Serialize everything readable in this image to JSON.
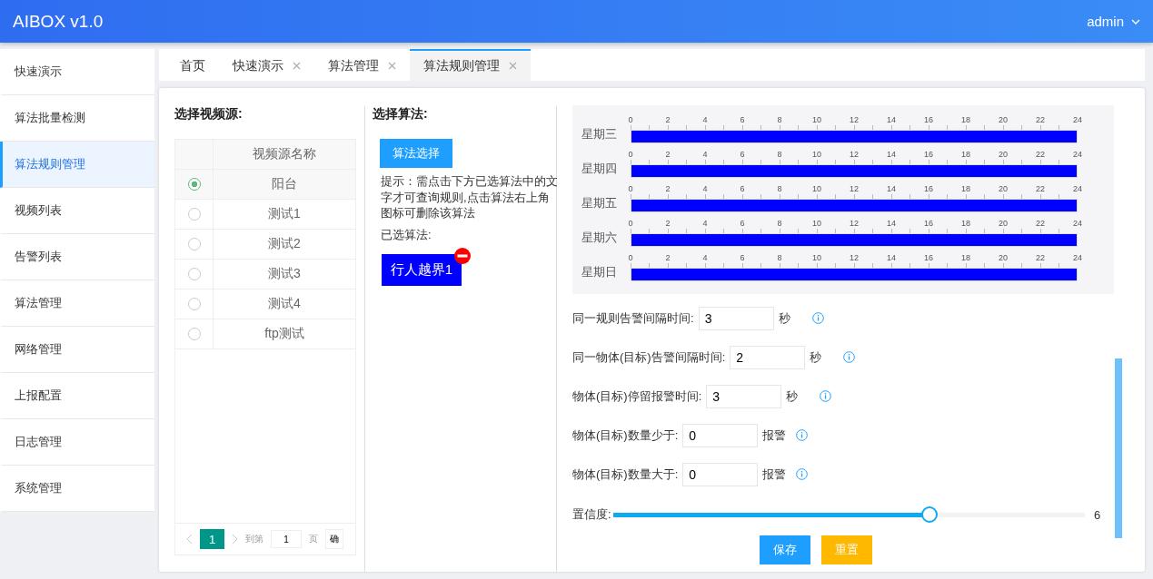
{
  "header": {
    "title": "AIBOX v1.0",
    "user": "admin"
  },
  "sidebar": {
    "items": [
      {
        "label": "快速演示",
        "selected": false
      },
      {
        "label": "算法批量检测",
        "selected": false
      },
      {
        "label": "算法规则管理",
        "selected": true
      },
      {
        "label": "视频列表",
        "selected": false
      },
      {
        "label": "告警列表",
        "selected": false
      },
      {
        "label": "算法管理",
        "selected": false
      },
      {
        "label": "网络管理",
        "selected": false
      },
      {
        "label": "上报配置",
        "selected": false
      },
      {
        "label": "日志管理",
        "selected": false
      },
      {
        "label": "系统管理",
        "selected": false
      }
    ]
  },
  "tabs": [
    {
      "label": "首页",
      "selected": false,
      "closable": false
    },
    {
      "label": "快速演示",
      "selected": false,
      "closable": true
    },
    {
      "label": "算法管理",
      "selected": false,
      "closable": true
    },
    {
      "label": "算法规则管理",
      "selected": true,
      "closable": true
    }
  ],
  "video_source": {
    "title": "选择视频源:",
    "column": "视频源名称",
    "rows": [
      {
        "name": "阳台",
        "selected": true
      },
      {
        "name": "测试1",
        "selected": false
      },
      {
        "name": "测试2",
        "selected": false
      },
      {
        "name": "测试3",
        "selected": false
      },
      {
        "name": "测试4",
        "selected": false
      },
      {
        "name": "ftp测试",
        "selected": false
      }
    ],
    "pagination": {
      "current": "1",
      "goto_label": "到第",
      "page_value": "1",
      "page_label": "页",
      "confirm": "确"
    }
  },
  "algorithm": {
    "title": "选择算法:",
    "select_button": "算法选择",
    "hint": "提示：需点击下方已选算法中的文字才可查询规则,点击算法右上角图标可删除该算法",
    "selected_label": "已选算法:",
    "selected": [
      "行人越界1"
    ]
  },
  "schedule": [
    {
      "day": "星期三",
      "level": 1,
      "ticks": [
        "0",
        "2",
        "4",
        "6",
        "8",
        "10",
        "12",
        "14",
        "16",
        "18",
        "20",
        "22",
        "24"
      ]
    },
    {
      "day": "星期四",
      "level": 1,
      "ticks": [
        "0",
        "2",
        "4",
        "6",
        "8",
        "10",
        "12",
        "14",
        "16",
        "18",
        "20",
        "22",
        "24"
      ]
    },
    {
      "day": "星期五",
      "level": 1,
      "ticks": [
        "0",
        "2",
        "4",
        "6",
        "8",
        "10",
        "12",
        "14",
        "16",
        "18",
        "20",
        "22",
        "24"
      ]
    },
    {
      "day": "星期六",
      "level": 1,
      "ticks": [
        "0",
        "2",
        "4",
        "6",
        "8",
        "10",
        "12",
        "14",
        "16",
        "18",
        "20",
        "22",
        "24"
      ]
    },
    {
      "day": "星期日",
      "level": 1,
      "ticks": [
        "0",
        "2",
        "4",
        "6",
        "8",
        "10",
        "12",
        "14",
        "16",
        "18",
        "20",
        "22",
        "24"
      ]
    }
  ],
  "rules": [
    {
      "label": "同一规则告警间隔时间:",
      "value": "3",
      "unit": "秒"
    },
    {
      "label": "同一物体(目标)告警间隔时间:",
      "value": "2",
      "unit": "秒"
    },
    {
      "label": "物体(目标)停留报警时间:",
      "value": "3",
      "unit": "秒"
    },
    {
      "label": "物体(目标)数量少于:",
      "value": "0",
      "unit": "报警"
    },
    {
      "label": "物体(目标)数量大于:",
      "value": "0",
      "unit": "报警"
    }
  ],
  "confidence": {
    "label": "置信度:",
    "level": 0.67,
    "reading": "6"
  },
  "buttons": {
    "save": "保存",
    "reset": "重置"
  }
}
